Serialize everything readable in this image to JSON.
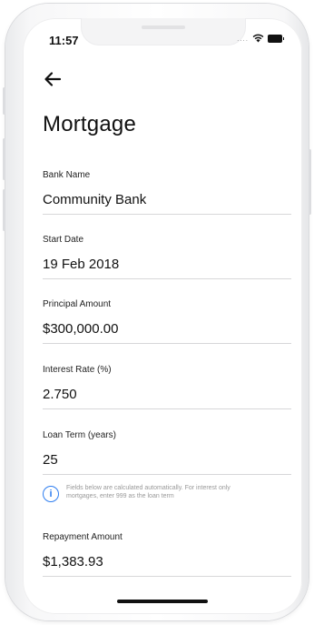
{
  "status_bar": {
    "time": "11:57",
    "dots": "....",
    "wifi_icon": "wifi-icon",
    "battery_icon": "battery-icon"
  },
  "nav": {
    "back_icon": "back-arrow-icon"
  },
  "page": {
    "title": "Mortgage"
  },
  "fields": {
    "bank_name": {
      "label": "Bank Name",
      "value": "Community Bank"
    },
    "start_date": {
      "label": "Start Date",
      "value": "19 Feb 2018"
    },
    "principal": {
      "label": "Principal Amount",
      "value": "$300,000.00"
    },
    "interest": {
      "label": "Interest Rate (%)",
      "value": "2.750"
    },
    "term": {
      "label": "Loan Term (years)",
      "value": "25"
    },
    "repayment": {
      "label": "Repayment Amount",
      "value": "$1,383.93"
    }
  },
  "info": {
    "icon": "info-icon",
    "line1": "Fields below are calculated automatically. For interest only",
    "line2": "mortgages, enter 999 as the loan term"
  },
  "colors": {
    "accent": "#2f7ef0"
  }
}
